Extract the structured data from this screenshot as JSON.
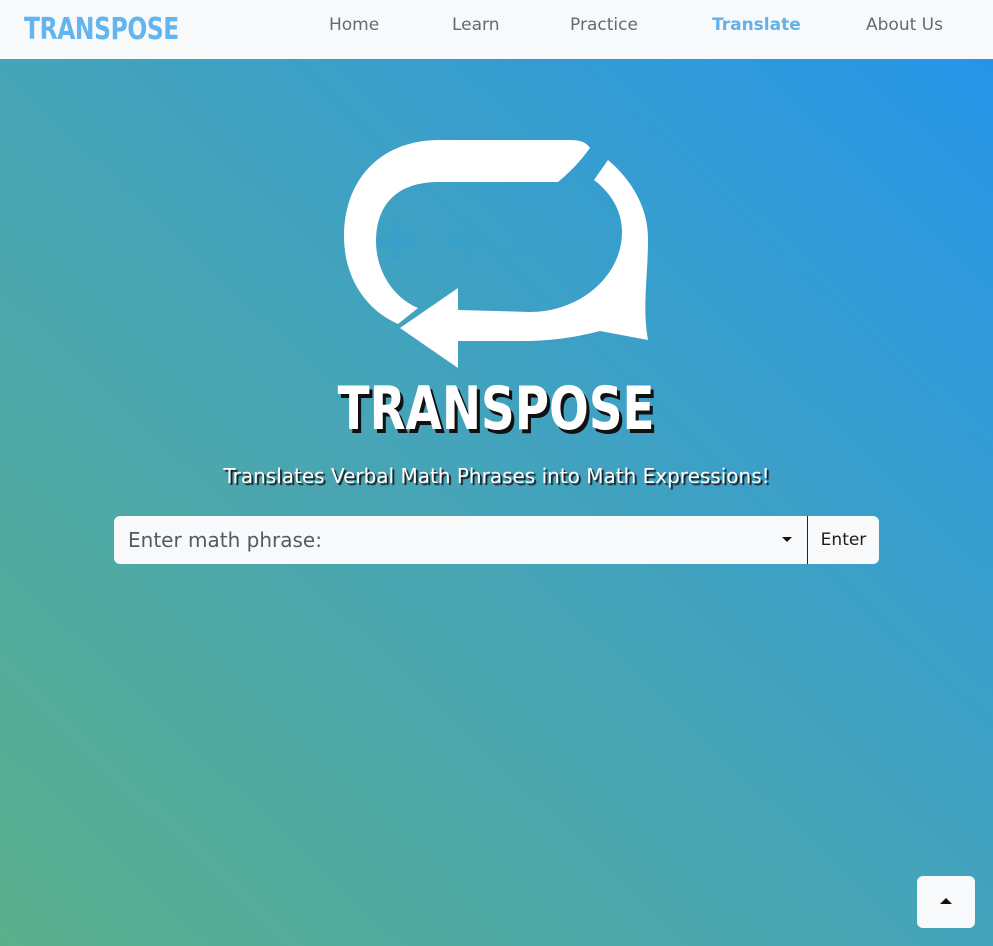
{
  "navbar": {
    "brand": "TRANSPOSE",
    "links": [
      {
        "label": "Home",
        "active": false
      },
      {
        "label": "Learn",
        "active": false
      },
      {
        "label": "Practice",
        "active": false
      },
      {
        "label": "Translate",
        "active": true
      },
      {
        "label": "About Us",
        "active": false
      }
    ]
  },
  "hero": {
    "logo_icon": "transpose-logo-icon",
    "logo_symbols": [
      "+",
      "÷",
      "×",
      "−"
    ],
    "title": "TRANSPOSE",
    "subtitle": "Translates Verbal Math Phrases into Math Expressions!"
  },
  "search": {
    "placeholder": "Enter math phrase:",
    "value": "",
    "dropdown_icon": "caret-down-icon",
    "button_label": "Enter"
  },
  "scroll_top": {
    "icon": "caret-up-icon"
  },
  "colors": {
    "nav_background": "#f8f9fa",
    "brand": "#63b5f0",
    "active_link": "#62b1ea",
    "link": "#666a70",
    "gradient_start": "#5aaf8b",
    "gradient_end": "#2494ec"
  }
}
